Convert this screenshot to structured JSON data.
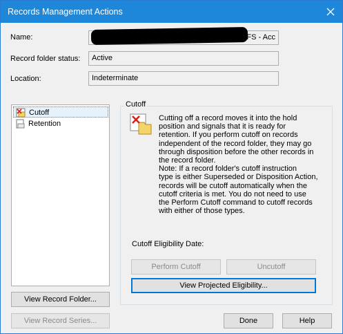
{
  "window": {
    "title": "Records Management Actions",
    "close_icon": "close-icon"
  },
  "fields": {
    "name_label": "Name:",
    "name_value_visible": "DFS - Acc",
    "status_label": "Record folder status:",
    "status_value": "Active",
    "location_label": "Location:",
    "location_value": "Indeterminate"
  },
  "actions_list": {
    "items": [
      {
        "label": "Cutoff",
        "icon": "cutoff-icon",
        "selected": true
      },
      {
        "label": "Retention",
        "icon": "retention-icon",
        "selected": false
      }
    ]
  },
  "cutoff_panel": {
    "group_label": "Cutoff",
    "icon": "cutoff-folder-icon",
    "description": "Cutting off a record moves it into the hold\nposition and signals that it is ready for\nretention.  If you perform cutoff on records\nindependent of the record folder, they may go\nthrough disposition before the other records in\nthe record folder.\nNote: If a record folder's cutoff instruction\ntype is either Superseded or Disposition Action,\nrecords will be cutoff automatically when the\ncutoff criteria is met.  You do not need to use\nthe Perform Cutoff command to cutoff records\nwith either of those types.",
    "eligibility_label": "Cutoff Eligibility Date:",
    "perform_cutoff": "Perform Cutoff",
    "uncutoff": "Uncutoff",
    "view_projected": "View Projected Eligibility..."
  },
  "buttons": {
    "view_record_folder": "View Record Folder...",
    "view_record_series": "View Record Series...",
    "done": "Done",
    "help": "Help"
  },
  "colors": {
    "titlebar": "#1e87d9",
    "accent": "#0078d7",
    "cutoff_red": "#d9201a",
    "folder_yellow": "#f5d36b"
  }
}
